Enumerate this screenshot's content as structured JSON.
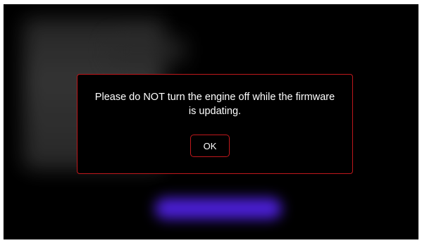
{
  "dialog": {
    "message": "Please do NOT turn the engine off while the firmware is updating.",
    "ok_label": "OK"
  },
  "colors": {
    "background": "#000000",
    "accent_border": "#c0181c",
    "blurred_button": "#4b1fd6",
    "text": "#ffffff"
  }
}
